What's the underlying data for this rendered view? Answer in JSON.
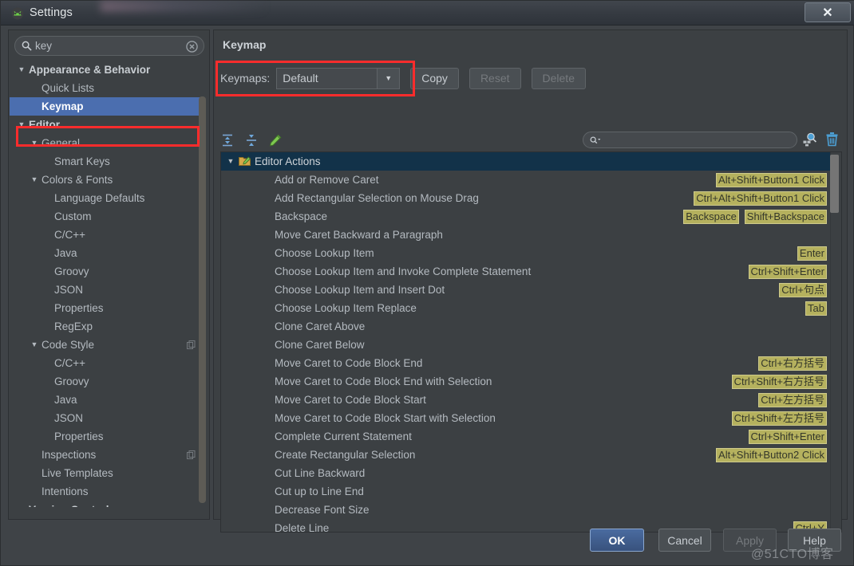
{
  "window": {
    "title": "Settings",
    "app_icon": "android-studio-icon",
    "close_label": "✕"
  },
  "sidebar": {
    "search": {
      "value": "key",
      "placeholder": "",
      "icon": "search-icon",
      "clear_icon": "clear-icon"
    },
    "items": [
      {
        "label": "Appearance & Behavior",
        "depth": 0,
        "expanded": true,
        "bold": true,
        "selected": false,
        "copy": false
      },
      {
        "label": "Quick Lists",
        "depth": 1,
        "expanded": null,
        "bold": false,
        "selected": false,
        "copy": false
      },
      {
        "label": "Keymap",
        "depth": 1,
        "expanded": null,
        "bold": true,
        "selected": true,
        "copy": false
      },
      {
        "label": "Editor",
        "depth": 0,
        "expanded": true,
        "bold": true,
        "selected": false,
        "copy": false
      },
      {
        "label": "General",
        "depth": 1,
        "expanded": true,
        "bold": false,
        "selected": false,
        "copy": false
      },
      {
        "label": "Smart Keys",
        "depth": 2,
        "expanded": null,
        "bold": false,
        "selected": false,
        "copy": false
      },
      {
        "label": "Colors & Fonts",
        "depth": 1,
        "expanded": true,
        "bold": false,
        "selected": false,
        "copy": false
      },
      {
        "label": "Language Defaults",
        "depth": 2,
        "expanded": null,
        "bold": false,
        "selected": false,
        "copy": false
      },
      {
        "label": "Custom",
        "depth": 2,
        "expanded": null,
        "bold": false,
        "selected": false,
        "copy": false
      },
      {
        "label": "C/C++",
        "depth": 2,
        "expanded": null,
        "bold": false,
        "selected": false,
        "copy": false
      },
      {
        "label": "Java",
        "depth": 2,
        "expanded": null,
        "bold": false,
        "selected": false,
        "copy": false
      },
      {
        "label": "Groovy",
        "depth": 2,
        "expanded": null,
        "bold": false,
        "selected": false,
        "copy": false
      },
      {
        "label": "JSON",
        "depth": 2,
        "expanded": null,
        "bold": false,
        "selected": false,
        "copy": false
      },
      {
        "label": "Properties",
        "depth": 2,
        "expanded": null,
        "bold": false,
        "selected": false,
        "copy": false
      },
      {
        "label": "RegExp",
        "depth": 2,
        "expanded": null,
        "bold": false,
        "selected": false,
        "copy": false
      },
      {
        "label": "Code Style",
        "depth": 1,
        "expanded": true,
        "bold": false,
        "selected": false,
        "copy": true
      },
      {
        "label": "C/C++",
        "depth": 2,
        "expanded": null,
        "bold": false,
        "selected": false,
        "copy": false
      },
      {
        "label": "Groovy",
        "depth": 2,
        "expanded": null,
        "bold": false,
        "selected": false,
        "copy": false
      },
      {
        "label": "Java",
        "depth": 2,
        "expanded": null,
        "bold": false,
        "selected": false,
        "copy": false
      },
      {
        "label": "JSON",
        "depth": 2,
        "expanded": null,
        "bold": false,
        "selected": false,
        "copy": false
      },
      {
        "label": "Properties",
        "depth": 2,
        "expanded": null,
        "bold": false,
        "selected": false,
        "copy": false
      },
      {
        "label": "Inspections",
        "depth": 1,
        "expanded": null,
        "bold": false,
        "selected": false,
        "copy": true
      },
      {
        "label": "Live Templates",
        "depth": 1,
        "expanded": null,
        "bold": false,
        "selected": false,
        "copy": false
      },
      {
        "label": "Intentions",
        "depth": 1,
        "expanded": null,
        "bold": false,
        "selected": false,
        "copy": false
      },
      {
        "label": "Version Control",
        "depth": 0,
        "expanded": true,
        "bold": true,
        "selected": false,
        "copy": false
      }
    ]
  },
  "keymap_pane": {
    "title": "Keymap",
    "keymaps_label": "Keymaps:",
    "keymaps_value": "Default",
    "keymaps_arrow": "▼",
    "buttons": [
      {
        "label": "Copy",
        "enabled": true
      },
      {
        "label": "Reset",
        "enabled": false
      },
      {
        "label": "Delete",
        "enabled": false
      }
    ],
    "toolbar_icons": [
      "expand-all-icon",
      "collapse-all-icon",
      "edit-shortcut-icon"
    ],
    "filter": {
      "value": "",
      "placeholder": "",
      "icon": "search-dropdown-icon"
    },
    "right_icons": [
      "find-shortcut-icon",
      "clear-filter-trash-icon"
    ],
    "rows": [
      {
        "type": "group",
        "label": "Editor Actions",
        "icon": "editor-actions-folder-icon",
        "expanded": true,
        "shortcuts": []
      },
      {
        "type": "action",
        "label": "Add or Remove Caret",
        "shortcuts": [
          "Alt+Shift+Button1 Click"
        ]
      },
      {
        "type": "action",
        "label": "Add Rectangular Selection on Mouse Drag",
        "shortcuts": [
          "Ctrl+Alt+Shift+Button1 Click"
        ]
      },
      {
        "type": "action",
        "label": "Backspace",
        "shortcuts": [
          "Backspace",
          "Shift+Backspace"
        ]
      },
      {
        "type": "action",
        "label": "Move Caret Backward a Paragraph",
        "shortcuts": []
      },
      {
        "type": "action",
        "label": "Choose Lookup Item",
        "shortcuts": [
          "Enter"
        ]
      },
      {
        "type": "action",
        "label": "Choose Lookup Item and Invoke Complete Statement",
        "shortcuts": [
          "Ctrl+Shift+Enter"
        ]
      },
      {
        "type": "action",
        "label": "Choose Lookup Item and Insert Dot",
        "shortcuts": [
          "Ctrl+句点"
        ]
      },
      {
        "type": "action",
        "label": "Choose Lookup Item Replace",
        "shortcuts": [
          "Tab"
        ]
      },
      {
        "type": "action",
        "label": "Clone Caret Above",
        "shortcuts": []
      },
      {
        "type": "action",
        "label": "Clone Caret Below",
        "shortcuts": []
      },
      {
        "type": "action",
        "label": "Move Caret to Code Block End",
        "shortcuts": [
          "Ctrl+右方括号"
        ]
      },
      {
        "type": "action",
        "label": "Move Caret to Code Block End with Selection",
        "shortcuts": [
          "Ctrl+Shift+右方括号"
        ]
      },
      {
        "type": "action",
        "label": "Move Caret to Code Block Start",
        "shortcuts": [
          "Ctrl+左方括号"
        ]
      },
      {
        "type": "action",
        "label": "Move Caret to Code Block Start with Selection",
        "shortcuts": [
          "Ctrl+Shift+左方括号"
        ]
      },
      {
        "type": "action",
        "label": "Complete Current Statement",
        "shortcuts": [
          "Ctrl+Shift+Enter"
        ]
      },
      {
        "type": "action",
        "label": "Create Rectangular Selection",
        "shortcuts": [
          "Alt+Shift+Button2 Click"
        ]
      },
      {
        "type": "action",
        "label": "Cut Line Backward",
        "shortcuts": []
      },
      {
        "type": "action",
        "label": "Cut up to Line End",
        "shortcuts": []
      },
      {
        "type": "action",
        "label": "Decrease Font Size",
        "shortcuts": []
      },
      {
        "type": "action",
        "label": "Delete Line",
        "shortcuts": [
          "Ctrl+Y"
        ]
      }
    ]
  },
  "footer": {
    "ok": "OK",
    "cancel": "Cancel",
    "apply": "Apply",
    "help": "Help"
  },
  "watermark": "@51CTO博客",
  "colors": {
    "accent_selection": "#4b6eaf",
    "group_row": "#123249",
    "shortcut_badge": "#b5b15e",
    "highlight_box": "#fb2c2c",
    "panel_bg": "#3c4043"
  }
}
